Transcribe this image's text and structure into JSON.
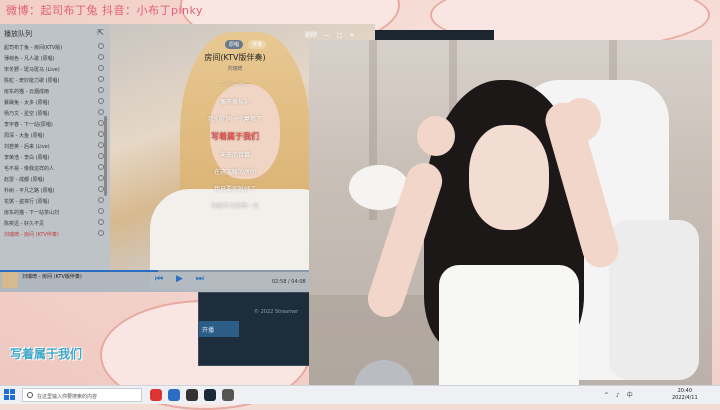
{
  "overlay": {
    "top_text": "微博：起司布丁兔   抖音：小布丁pinky",
    "bottom_lyric": "写着属于我们"
  },
  "player": {
    "queue_title": "播放队列",
    "queue_icon": "pin-icon",
    "queue_items": [
      "起司布丁兔 - 房间(KTV版)",
      "薄荷色 - 凡人歌 (原唱)",
      "宋冬野 - 斑马斑马 (Live)",
      "陈粒 - 奇妙能力歌 (原唱)",
      "房东的猫 - 云烟成雨",
      "暴躁兔 - 太多 (原唱)",
      "杨乃文 - 星空 (原唱)",
      "李宇春 - 下一站(原唱)",
      "周深 - 大鱼 (原唱)",
      "刘若英 - 后来 (Live)",
      "李荣浩 - 李白 (原唱)",
      "毛不易 - 像我这样的人",
      "赵雷 - 成都 (原唱)",
      "朴树 - 平凡之路 (原唱)",
      "花粥 - 盗将行 (原唱)",
      "房东的猫 - 下一站茶山刘",
      "陈奕迅 - 好久不见",
      "刘瑞琦 - 房间 (KTV伴奏)"
    ],
    "active_index": 17,
    "modes": [
      "原唱",
      "伴奏"
    ],
    "window_controls": [
      "删除",
      "—",
      "□",
      "✕"
    ],
    "song_title": "房间(KTV版伴奏)",
    "song_subtitle": "刘瑞琦",
    "lyrics": [
      "一个一个一",
      "像不像从前",
      "我们在同一个屋檐下",
      "写着属于我们",
      "未来的诗篇",
      "在这温暖的房间",
      "我只要你就好了",
      "可能平凡的每一天"
    ],
    "current_lyric_index": 3,
    "now_playing": "刘瑞琦 - 房间 (KTV版伴奏)",
    "time": "02:58 / 04:08",
    "progress_pct": 42
  },
  "stream_app": {
    "button_label": "开播",
    "info_text": "© 2022 Streamer"
  },
  "taskbar": {
    "search_placeholder": "在这里输入你要搜索的内容",
    "tray_icons": [
      "^",
      "♪",
      "中"
    ],
    "clock_time": "20:40",
    "clock_date": "2022/4/11"
  },
  "colors": {
    "accent": "#2a6ec4",
    "current_lyric": "#e2504e",
    "overlay_pink": "#e0607a",
    "overlay_blue": "#3fa7c9"
  }
}
